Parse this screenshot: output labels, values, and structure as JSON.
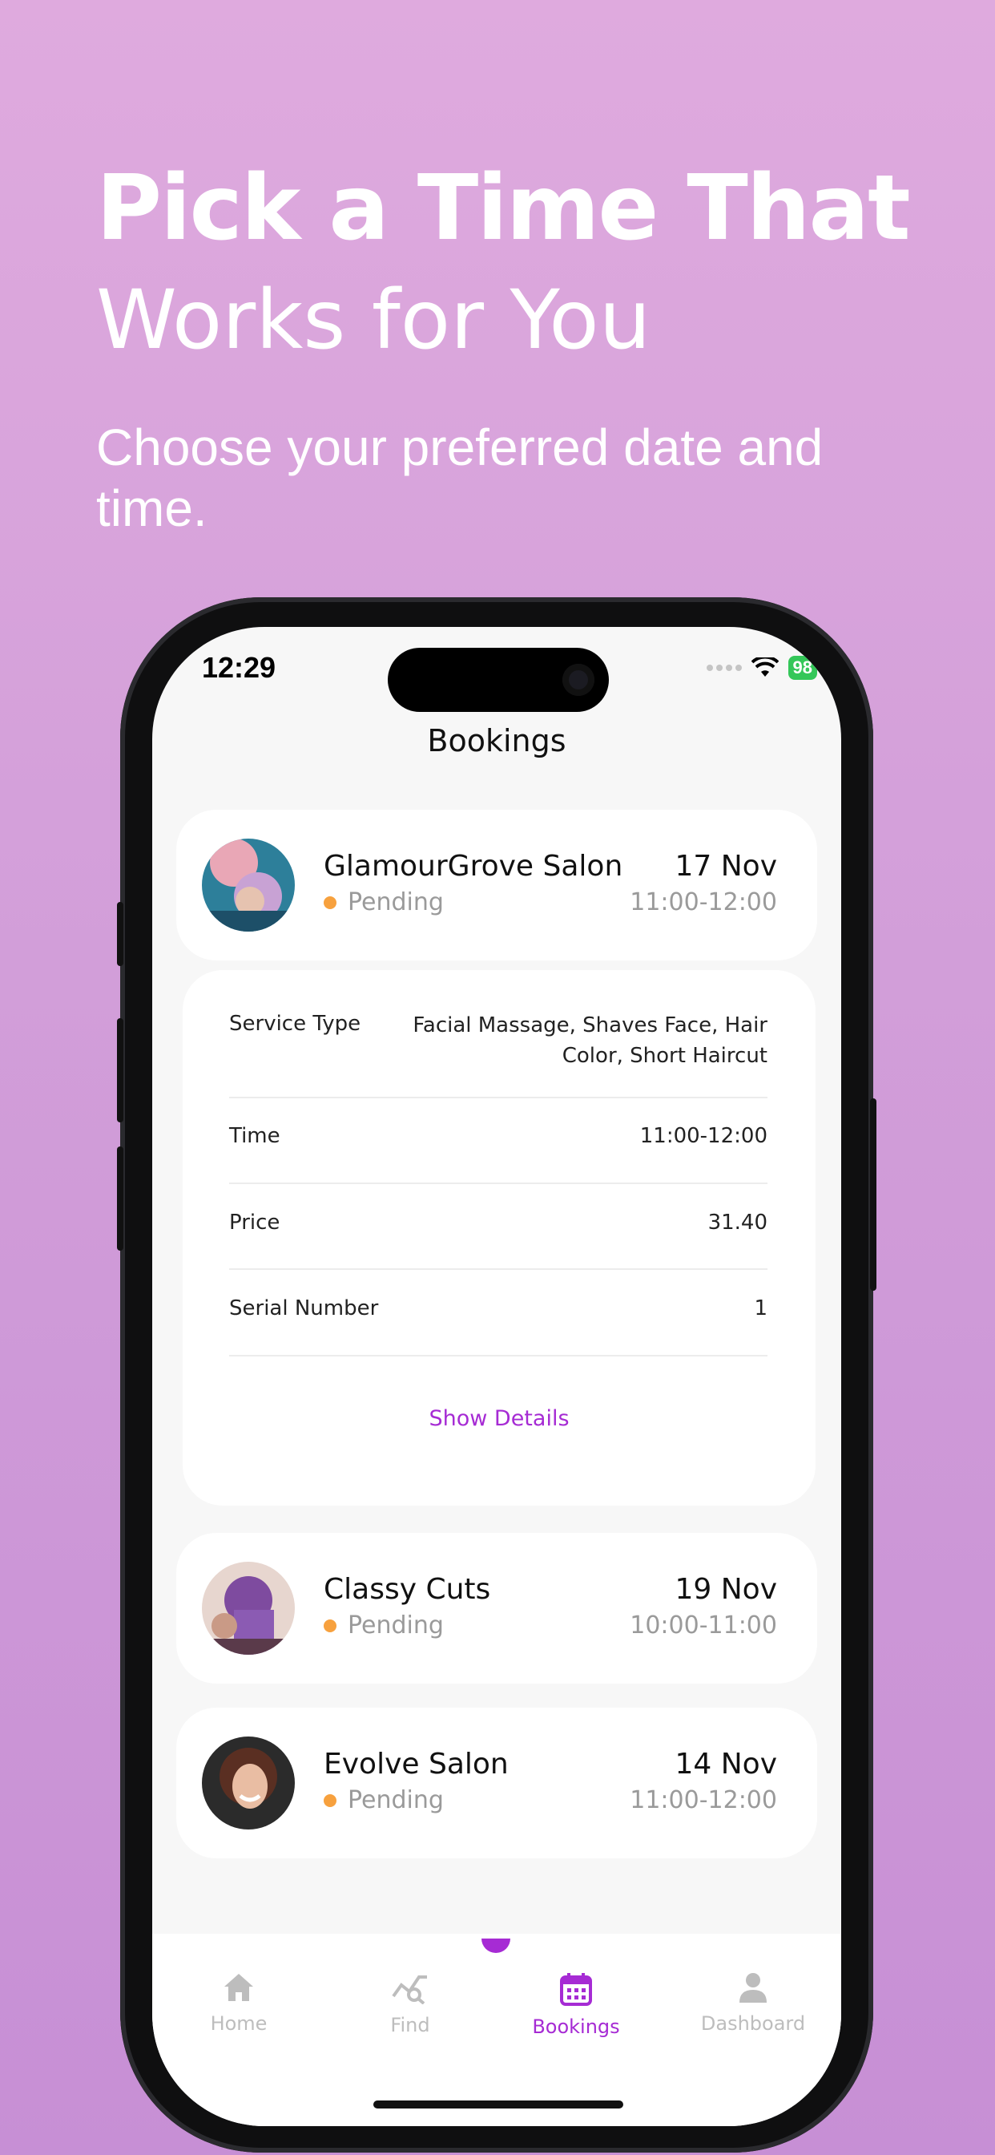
{
  "header": {
    "title_line1": "Pick a Time That",
    "title_line2": "Works for You",
    "subtitle": "Choose your preferred date and time."
  },
  "status_bar": {
    "time": "12:29",
    "battery": "98"
  },
  "page": {
    "title": "Bookings"
  },
  "bookings": [
    {
      "salon": "GlamourGrove Salon",
      "status": "Pending",
      "date": "17 Nov",
      "time": "11:00-12:00"
    },
    {
      "salon": "Classy Cuts",
      "status": "Pending",
      "date": "19 Nov",
      "time": "10:00-11:00"
    },
    {
      "salon": "Evolve Salon",
      "status": "Pending",
      "date": "14 Nov",
      "time": "11:00-12:00"
    }
  ],
  "details": {
    "service_type_label": "Service Type",
    "service_type_value_line1": "Facial Massage, Shaves Face, Hair",
    "service_type_value_line2": "Color, Short Haircut",
    "time_label": "Time",
    "time_value": "11:00-12:00",
    "price_label": "Price",
    "price_value": "31.40",
    "serial_label": "Serial Number",
    "serial_value": "1",
    "show_details": "Show Details"
  },
  "tabs": [
    {
      "label": "Home",
      "icon": "home-icon"
    },
    {
      "label": "Find",
      "icon": "chart-search-icon"
    },
    {
      "label": "Bookings",
      "icon": "calendar-icon",
      "active": true
    },
    {
      "label": "Dashboard",
      "icon": "user-icon"
    }
  ],
  "colors": {
    "accent": "#a62bd4",
    "pending": "#f7a13e",
    "battery": "#34c759"
  }
}
